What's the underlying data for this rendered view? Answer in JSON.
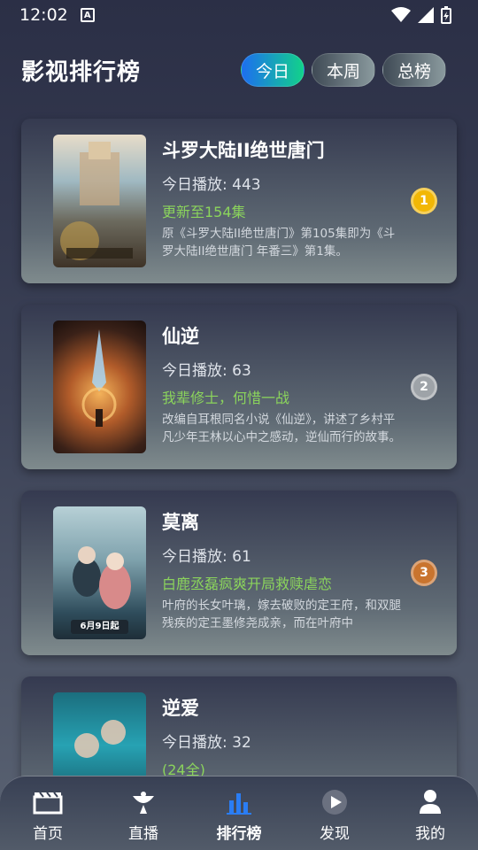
{
  "status": {
    "time": "12:02",
    "notif_letter": "A"
  },
  "header": {
    "title": "影视排行榜",
    "tabs": [
      {
        "label": "今日",
        "active": true
      },
      {
        "label": "本周",
        "active": false
      },
      {
        "label": "总榜",
        "active": false
      }
    ]
  },
  "shows": [
    {
      "title": "斗罗大陆II绝世唐门",
      "plays": "今日播放: 443",
      "update": "更新至154集",
      "desc": "原《斗罗大陆II绝世唐门》第105集即为《斗罗大陆II绝世唐门 年番三》第1集。",
      "rank": "1",
      "rank_color": "#f2b705"
    },
    {
      "title": "仙逆",
      "plays": "今日播放: 63",
      "update": "我辈修士，何惜一战",
      "desc": "改编自耳根同名小说《仙逆》，讲述了乡村平凡少年王林以心中之感动，逆仙而行的故事。",
      "rank": "2",
      "rank_color": "#9ea3a8"
    },
    {
      "title": "莫离",
      "plays": "今日播放: 61",
      "update": "白鹿丞磊疯爽开局救赎虐恋",
      "desc": "叶府的长女叶璃，嫁去破败的定王府，和双腿残疾的定王墨修尧成亲，而在叶府中",
      "rank": "3",
      "rank_color": "#c9742e",
      "poster_caption": "6月9日起"
    },
    {
      "title": "逆爱",
      "plays": "今日播放: 32",
      "update": "(24全)",
      "desc": "",
      "rank": "",
      "rank_color": ""
    }
  ],
  "nav": [
    {
      "label": "首页",
      "icon": "clapperboard-icon",
      "active": false
    },
    {
      "label": "直播",
      "icon": "satellite-dish-icon",
      "active": false
    },
    {
      "label": "排行榜",
      "icon": "bar-chart-icon",
      "active": true
    },
    {
      "label": "发现",
      "icon": "play-circle-icon",
      "active": false
    },
    {
      "label": "我的",
      "icon": "person-icon",
      "active": false
    }
  ]
}
